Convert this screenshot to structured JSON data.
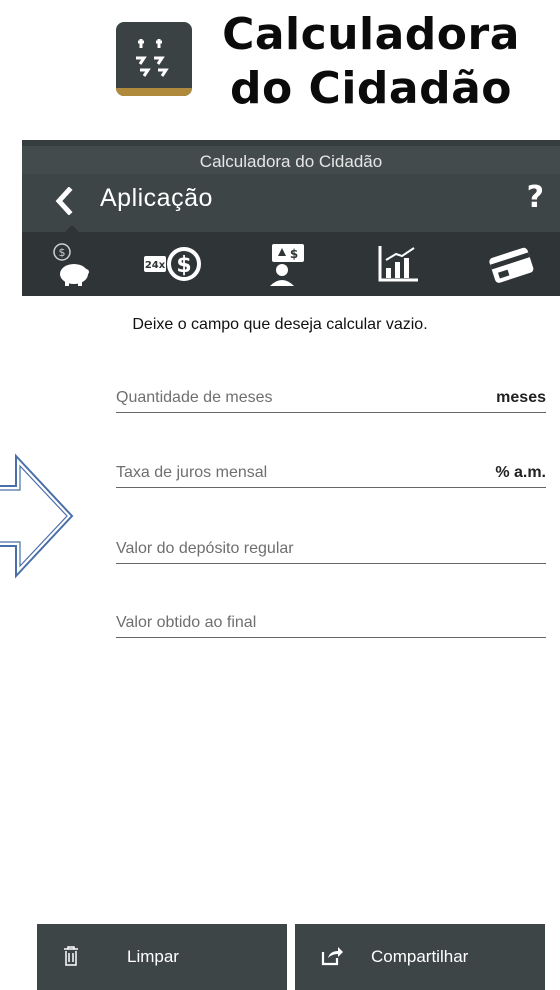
{
  "promo": {
    "title_line1": "Calculadora",
    "title_line2": "do Cidadão",
    "logo_icon": "arrows-logo-icon"
  },
  "header": {
    "window_title": "Calculadora do Cidadão",
    "screen_title": "Aplicação",
    "help_label": "?",
    "back_icon": "chevron-left-icon"
  },
  "tabs": [
    {
      "icon": "piggy-bank-icon",
      "active": true
    },
    {
      "icon": "installments-24x-icon",
      "active": false
    },
    {
      "icon": "person-exchange-icon",
      "active": false
    },
    {
      "icon": "bar-chart-icon",
      "active": false
    },
    {
      "icon": "credit-card-icon",
      "active": false
    }
  ],
  "main": {
    "instruction": "Deixe o campo que deseja calcular vazio.",
    "fields": [
      {
        "placeholder": "Quantidade de meses",
        "unit": "meses"
      },
      {
        "placeholder": "Taxa de juros mensal",
        "unit": "% a.m."
      },
      {
        "placeholder": "Valor do depósito regular",
        "unit": ""
      },
      {
        "placeholder": "Valor obtido ao final",
        "unit": ""
      }
    ]
  },
  "footer": {
    "clear_label": "Limpar",
    "share_label": "Compartilhar"
  },
  "colors": {
    "header_bg": "#3d4547",
    "tabs_bg": "#2f3537",
    "logo_accent": "#b08a3c",
    "arrow_stroke": "#4a6fa8"
  }
}
